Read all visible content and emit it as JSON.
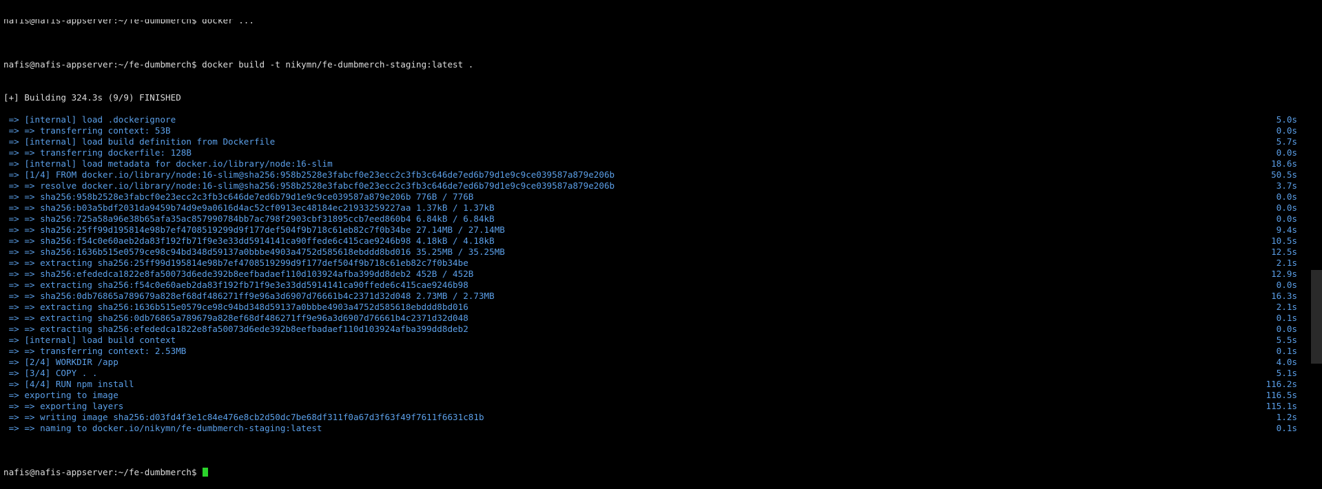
{
  "terminal": {
    "partial_top_line": "nafis@nafis-appserver:~/fe-dumbmerch$ docker ...",
    "command_line": "nafis@nafis-appserver:~/fe-dumbmerch$ docker build -t nikymn/fe-dumbmerch-staging:latest .",
    "status_line": "[+] Building 324.3s (9/9) FINISHED",
    "build_lines": [
      {
        "text": " => [internal] load .dockerignore",
        "dur": "5.0s"
      },
      {
        "text": " => => transferring context: 53B",
        "dur": "0.0s"
      },
      {
        "text": " => [internal] load build definition from Dockerfile",
        "dur": "5.7s"
      },
      {
        "text": " => => transferring dockerfile: 128B",
        "dur": "0.0s"
      },
      {
        "text": " => [internal] load metadata for docker.io/library/node:16-slim",
        "dur": "18.6s"
      },
      {
        "text": " => [1/4] FROM docker.io/library/node:16-slim@sha256:958b2528e3fabcf0e23ecc2c3fb3c646de7ed6b79d1e9c9ce039587a879e206b",
        "dur": "50.5s"
      },
      {
        "text": " => => resolve docker.io/library/node:16-slim@sha256:958b2528e3fabcf0e23ecc2c3fb3c646de7ed6b79d1e9c9ce039587a879e206b",
        "dur": "3.7s"
      },
      {
        "text": " => => sha256:958b2528e3fabcf0e23ecc2c3fb3c646de7ed6b79d1e9c9ce039587a879e206b 776B / 776B",
        "dur": "0.0s"
      },
      {
        "text": " => => sha256:b03a5bdf2031da9459b74d9e9a0616d4ac52cf0913ec48184ec21933259227aa 1.37kB / 1.37kB",
        "dur": "0.0s"
      },
      {
        "text": " => => sha256:725a58a96e38b65afa35ac857990784bb7ac798f2903cbf31895ccb7eed860b4 6.84kB / 6.84kB",
        "dur": "0.0s"
      },
      {
        "text": " => => sha256:25ff99d195814e98b7ef4708519299d9f177def504f9b718c61eb82c7f0b34be 27.14MB / 27.14MB",
        "dur": "9.4s"
      },
      {
        "text": " => => sha256:f54c0e60aeb2da83f192fb71f9e3e33dd5914141ca90ffede6c415cae9246b98 4.18kB / 4.18kB",
        "dur": "10.5s"
      },
      {
        "text": " => => sha256:1636b515e0579ce98c94bd348d59137a0bbbe4903a4752d585618ebddd8bd016 35.25MB / 35.25MB",
        "dur": "12.5s"
      },
      {
        "text": " => => extracting sha256:25ff99d195814e98b7ef4708519299d9f177def504f9b718c61eb82c7f0b34be",
        "dur": "2.1s"
      },
      {
        "text": " => => sha256:efededca1822e8fa50073d6ede392b8eefbadaef110d103924afba399dd8deb2 452B / 452B",
        "dur": "12.9s"
      },
      {
        "text": " => => extracting sha256:f54c0e60aeb2da83f192fb71f9e3e33dd5914141ca90ffede6c415cae9246b98",
        "dur": "0.0s"
      },
      {
        "text": " => => sha256:0db76865a789679a828ef68df486271ff9e96a3d6907d76661b4c2371d32d048 2.73MB / 2.73MB",
        "dur": "16.3s"
      },
      {
        "text": " => => extracting sha256:1636b515e0579ce98c94bd348d59137a0bbbe4903a4752d585618ebddd8bd016",
        "dur": "2.1s"
      },
      {
        "text": " => => extracting sha256:0db76865a789679a828ef68df486271ff9e96a3d6907d76661b4c2371d32d048",
        "dur": "0.1s"
      },
      {
        "text": " => => extracting sha256:efededca1822e8fa50073d6ede392b8eefbadaef110d103924afba399dd8deb2",
        "dur": "0.0s"
      },
      {
        "text": " => [internal] load build context",
        "dur": "5.5s"
      },
      {
        "text": " => => transferring context: 2.53MB",
        "dur": "0.1s"
      },
      {
        "text": " => [2/4] WORKDIR /app",
        "dur": "4.0s"
      },
      {
        "text": " => [3/4] COPY . .",
        "dur": "5.1s"
      },
      {
        "text": " => [4/4] RUN npm install",
        "dur": "116.2s"
      },
      {
        "text": " => exporting to image",
        "dur": "116.5s"
      },
      {
        "text": " => => exporting layers",
        "dur": "115.1s"
      },
      {
        "text": " => => writing image sha256:d03fd4f3e1c84e476e8cb2d50dc7be68df311f0a67d3f63f49f7611f6631c81b",
        "dur": "1.2s"
      },
      {
        "text": " => => naming to docker.io/nikymn/fe-dumbmerch-staging:latest",
        "dur": "0.1s"
      }
    ],
    "prompt_line": "nafis@nafis-appserver:~/fe-dumbmerch$ ",
    "cursor_color": "#2bd42b",
    "accent_color": "#5b9fe8"
  }
}
